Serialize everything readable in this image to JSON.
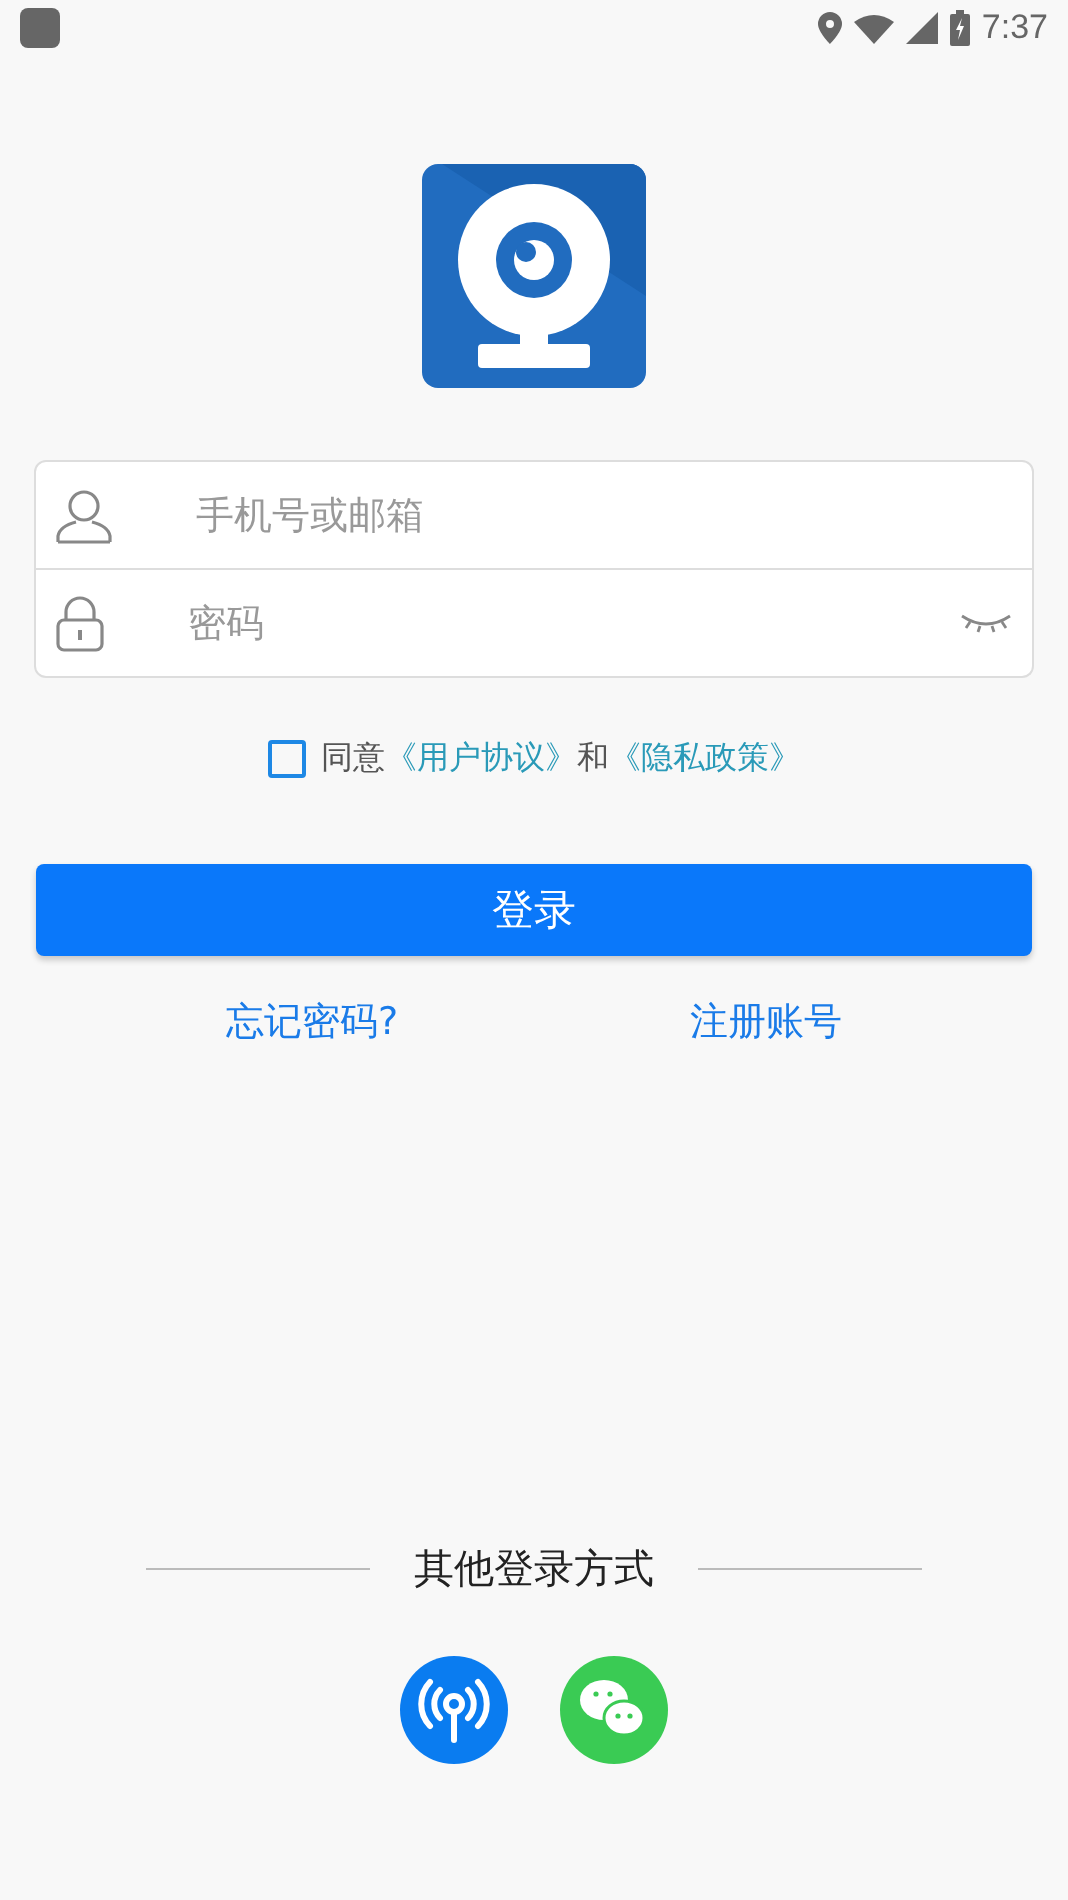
{
  "status_bar": {
    "time": "7:37"
  },
  "login_form": {
    "account_field": {
      "placeholder": "手机号或邮箱"
    },
    "password_field": {
      "placeholder": "密码"
    }
  },
  "agreement": {
    "checked": false,
    "prefix": "同意",
    "user_agreement": "《用户协议》",
    "joiner": "和",
    "privacy_policy": "《隐私政策》"
  },
  "login_button": "登录",
  "forgot_password": "忘记密码?",
  "register": "注册账号",
  "other_login": {
    "title": "其他登录方式",
    "methods": [
      {
        "kind": "hotspot"
      },
      {
        "kind": "wechat"
      }
    ]
  }
}
